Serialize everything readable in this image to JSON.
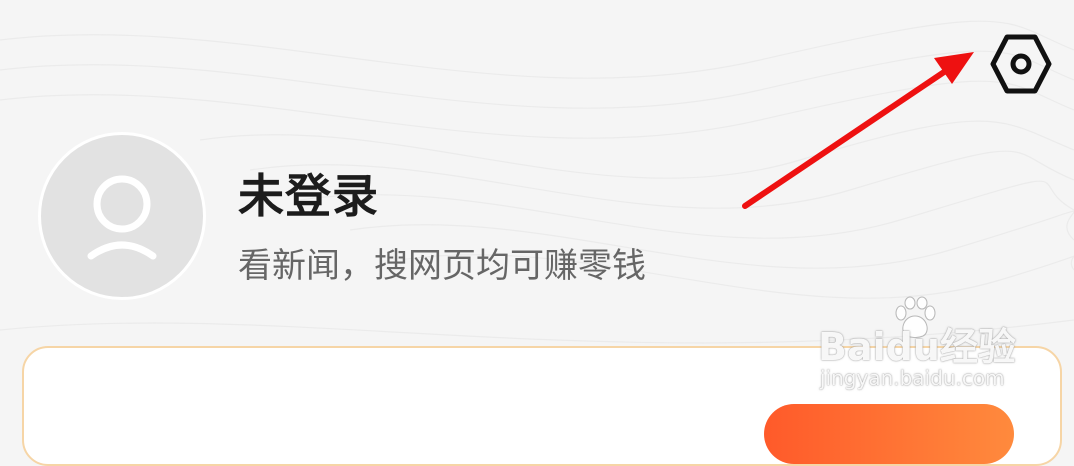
{
  "header": {
    "settings_icon": "gear-icon"
  },
  "profile": {
    "avatar_icon": "user-icon",
    "title": "未登录",
    "subtitle": "看新闻，搜网页均可赚零钱"
  },
  "annotation": {
    "arrow_color": "#ee1111"
  },
  "watermark": {
    "brand": "Baidu经验",
    "url": "jingyan.baidu.com"
  },
  "colors": {
    "background": "#f5f5f5",
    "card_border": "#f6d5a6",
    "accent": "#ff5a2a"
  }
}
